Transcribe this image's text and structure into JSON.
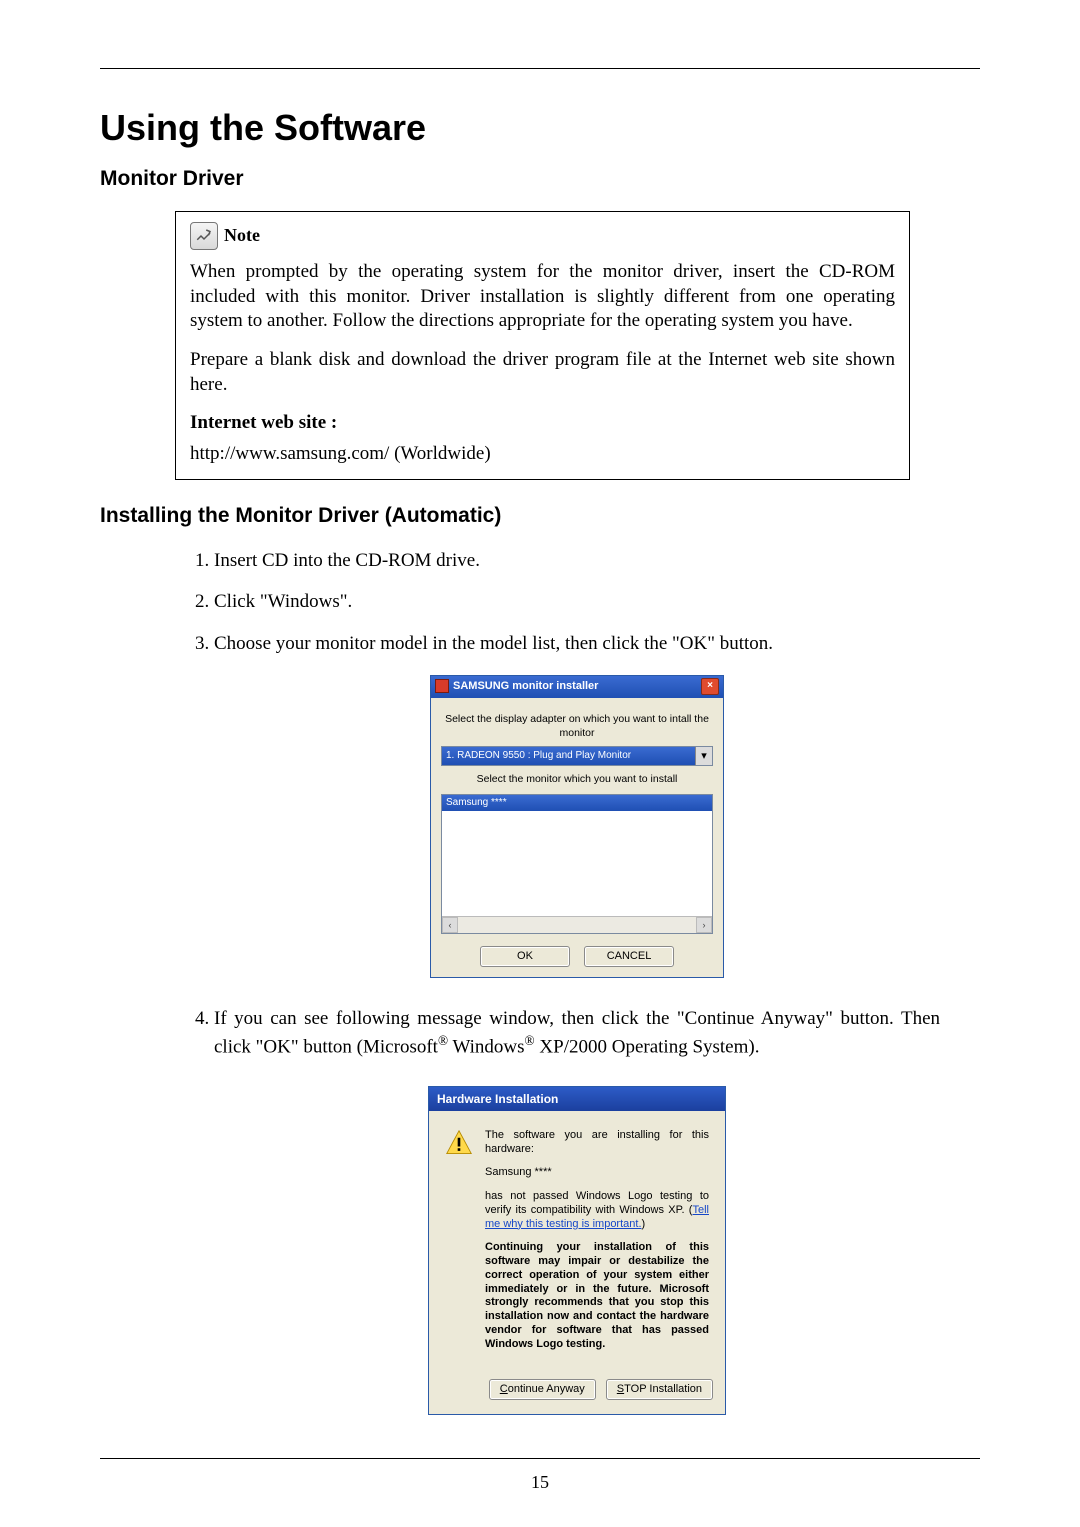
{
  "page": {
    "number": "15",
    "title": "Using the Software",
    "section1": "Monitor Driver",
    "section2": "Installing the Monitor Driver (Automatic)"
  },
  "note": {
    "label": "Note",
    "p1": "When prompted by the operating system for the monitor driver, insert the CD-ROM included with this monitor. Driver installation is slightly different from one operating system to another. Follow the directions appropriate for the operating system you have.",
    "p2": "Prepare a blank disk and download the driver program file at the Internet web site shown here.",
    "webLabel": "Internet web site :",
    "url": "http://www.samsung.com/ (Worldwide)"
  },
  "steps": {
    "s1": "Insert CD into the CD-ROM drive.",
    "s2": "Click \"Windows\".",
    "s3": "Choose your monitor model in the model list, then click the \"OK\" button.",
    "s4a": "If you can see following message window, then click the \"Continue Anyway\" button. Then click \"OK\" button (Microsoft",
    "s4b": " Windows",
    "s4c": " XP/2000 Operating System)."
  },
  "dlg1": {
    "title": "SAMSUNG monitor installer",
    "lbl1": "Select the display adapter on which you want to intall the monitor",
    "combo": "1. RADEON 9550 : Plug and Play Monitor",
    "lbl2": "Select the monitor which you want to install",
    "item": "Samsung ****",
    "ok": "OK",
    "cancel": "CANCEL"
  },
  "dlg2": {
    "title": "Hardware Installation",
    "p1": "The software you are installing for this hardware:",
    "hw": "Samsung ****",
    "p2a": "has not passed Windows Logo testing to verify its compatibility with Windows XP. (",
    "link": "Tell me why this testing is important.",
    "p2b": ")",
    "p3": "Continuing your installation of this software may impair or destabilize the correct operation of your system either immediately or in the future. Microsoft strongly recommends that you stop this installation now and contact the hardware vendor for software that has passed Windows Logo testing.",
    "btnContinue": "Continue Anyway",
    "btnStop": "STOP Installation"
  }
}
